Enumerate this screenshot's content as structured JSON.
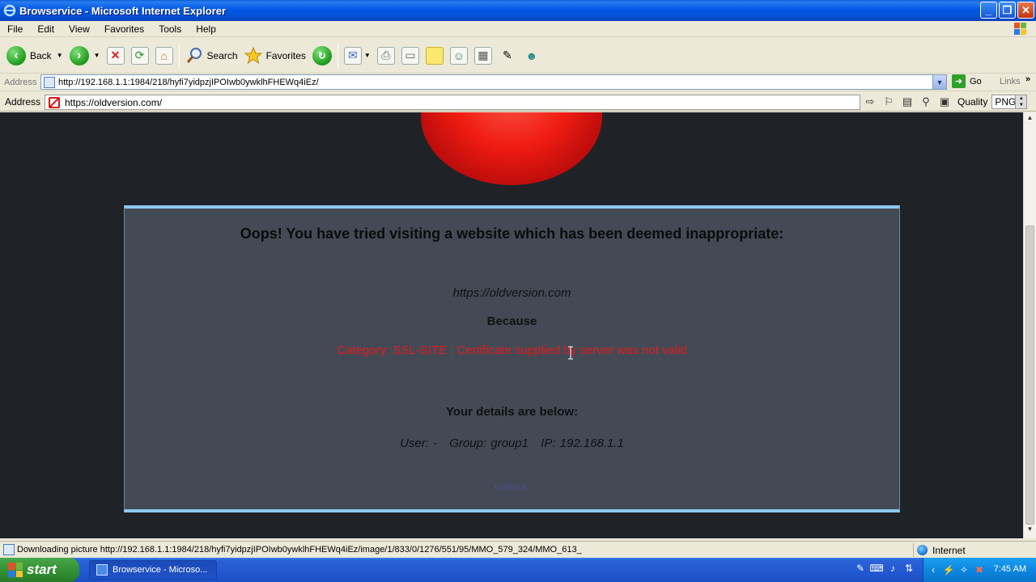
{
  "window": {
    "title": "Browservice - Microsoft Internet Explorer",
    "buttons": [
      "minimize",
      "maximize",
      "close"
    ]
  },
  "menu": [
    "File",
    "Edit",
    "View",
    "Favorites",
    "Tools",
    "Help"
  ],
  "toolbar": {
    "back_label": "Back",
    "search_label": "Search",
    "favorites_label": "Favorites"
  },
  "ie_address": {
    "label": "Address",
    "url": "http://192.168.1.1:1984/218/hyfi7yidpzjIPOIwb0ywklhFHEWq4iEz/",
    "go_label": "Go",
    "links_label": "Links"
  },
  "remote_address": {
    "label": "Address",
    "url": "https://oldversion.com/",
    "quality_label": "Quality",
    "quality_value": "PNG"
  },
  "block_page": {
    "heading": "Oops! You have tried visiting a website which has been deemed inappropriate:",
    "blocked_url": "https://oldversion.com",
    "because_label": "Because",
    "reason": "Category: SSL-SITE : Certificate supplied by server was not valid",
    "details_heading": "Your details are below:",
    "user": "User: -",
    "group": "Group: group1",
    "ip": "IP: 192.168.1.1",
    "footer_link": "Unblock"
  },
  "status": {
    "text": "Downloading picture http://192.168.1.1:1984/218/hyfi7yidpzjIPOIwb0ywklhFHEWq4iEz/image/1/833/0/1276/551/95/MMO_579_324/MMO_613_",
    "zone": "Internet"
  },
  "taskbar": {
    "start_label": "start",
    "task_label": "Browservice - Microso...",
    "clock": "7:45 AM"
  }
}
